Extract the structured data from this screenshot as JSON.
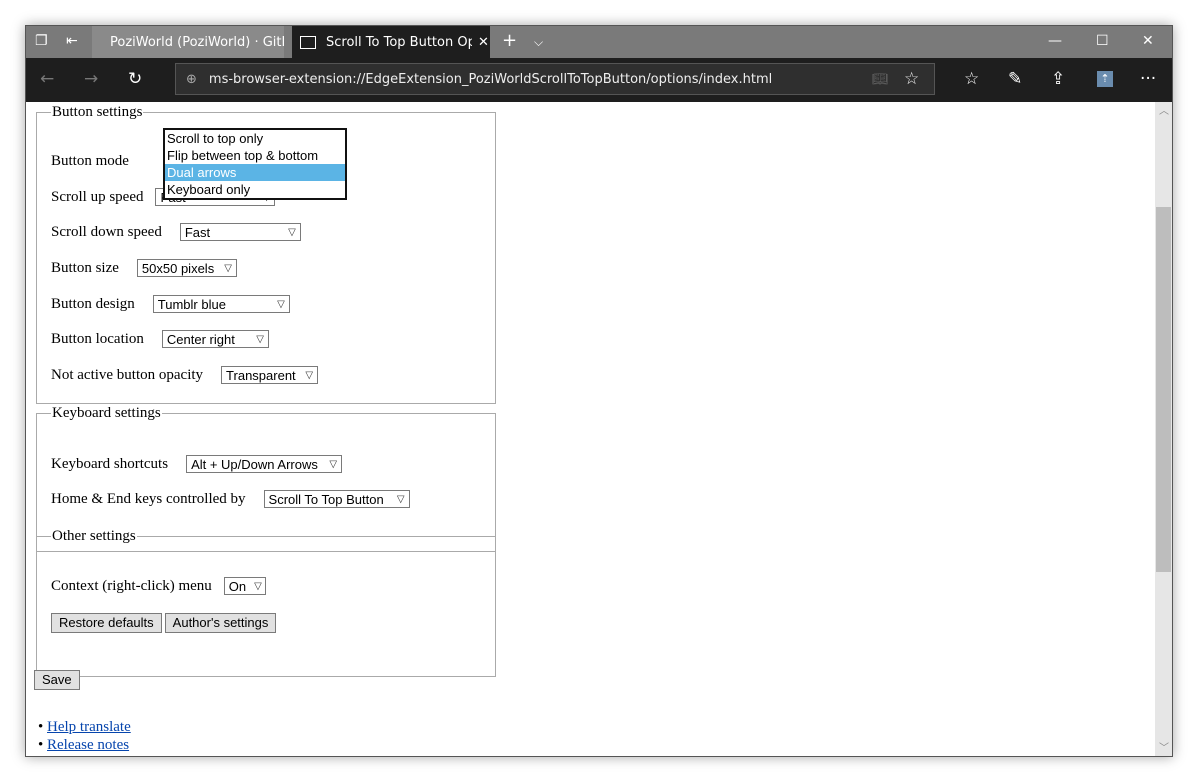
{
  "tabs": [
    {
      "title": "PoziWorld (PoziWorld) · GitH",
      "icon": "github-icon"
    },
    {
      "title": "Scroll To Top Button Op",
      "icon": "page-icon",
      "active": true
    }
  ],
  "address": "ms-browser-extension://EdgeExtension_PoziWorldScrollToTopButton/options/index.html",
  "button_settings": {
    "legend": "Button settings",
    "mode_label": "Button mode",
    "mode_options": [
      "Scroll to top only",
      "Flip between top & bottom",
      "Dual arrows",
      "Keyboard only"
    ],
    "mode_highlighted": "Dual arrows",
    "up_speed_label": "Scroll up speed",
    "up_speed": "Fast",
    "down_speed_label": "Scroll down speed",
    "down_speed": "Fast",
    "size_label": "Button size",
    "size": "50x50 pixels",
    "design_label": "Button design",
    "design": "Tumblr blue",
    "location_label": "Button location",
    "location": "Center right",
    "opacity_label": "Not active button opacity",
    "opacity": "Transparent"
  },
  "keyboard_settings": {
    "legend": "Keyboard settings",
    "shortcuts_label": "Keyboard shortcuts",
    "shortcuts": "Alt + Up/Down Arrows",
    "homeend_label": "Home & End keys controlled by",
    "homeend": "Scroll To Top Button"
  },
  "other_settings": {
    "legend": "Other settings",
    "context_label": "Context (right-click) menu",
    "context": "On",
    "restore_label": "Restore defaults",
    "author_label": "Author's settings"
  },
  "save_label": "Save",
  "links": [
    "Help translate",
    "Release notes"
  ],
  "colors": {
    "highlight": "#5bb4e5",
    "titlebar": "#7a7a7a",
    "toolbar": "#1e1e1e",
    "extension": "#6a8cae"
  }
}
